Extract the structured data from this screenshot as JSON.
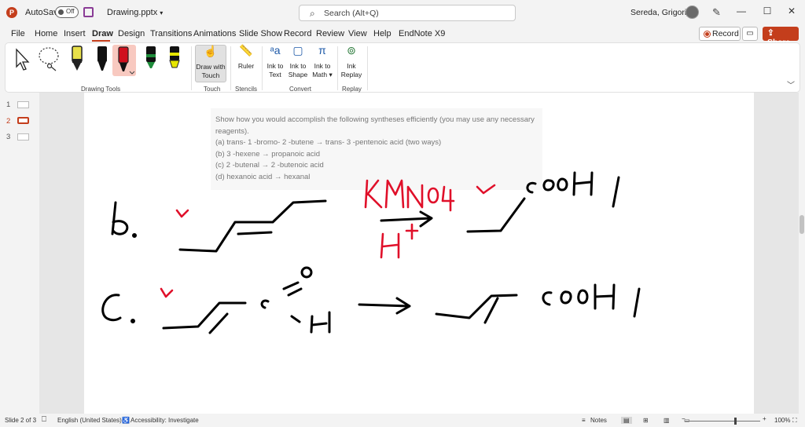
{
  "titlebar": {
    "autosave_label": "AutoSave",
    "autosave_state": "Off",
    "doc_title": "Drawing.pptx",
    "search_placeholder": "Search (Alt+Q)",
    "user_name": "Sereda, Grigoriy A",
    "minimize": "—",
    "maximize": "☐",
    "close": "✕"
  },
  "menu": {
    "tabs": [
      "File",
      "Home",
      "Insert",
      "Draw",
      "Design",
      "Transitions",
      "Animations",
      "Slide Show",
      "Record",
      "Review",
      "View",
      "Help",
      "EndNote X9"
    ],
    "active_tab": "Draw",
    "record_label": "Record",
    "share_label": "Share"
  },
  "ribbon": {
    "groups": {
      "drawing_tools": "Drawing Tools",
      "touch": "Touch",
      "stencils": "Stencils",
      "convert": "Convert",
      "replay": "Replay"
    },
    "buttons": {
      "draw_with_touch_1": "Draw with",
      "draw_with_touch_2": "Touch",
      "ruler": "Ruler",
      "ink_to_text_1": "Ink to",
      "ink_to_text_2": "Text",
      "ink_to_shape_1": "Ink to",
      "ink_to_shape_2": "Shape",
      "ink_to_math_1": "Ink to",
      "ink_to_math_2": "Math",
      "ink_replay_1": "Ink",
      "ink_replay_2": "Replay"
    },
    "pen_colors": [
      "#e8e04a",
      "#111111",
      "#d0101e",
      "#1f8c3b",
      "#e6e600"
    ]
  },
  "thumbnails": [
    "1",
    "2",
    "3"
  ],
  "active_slide": "2",
  "slide": {
    "question": [
      "Show how you would accomplish the following syntheses efficiently (you may use any necessary reagents).",
      "(a) trans- 1 -bromo- 2 -butene → trans- 3 -pentenoic acid (two ways)",
      "(b) 3 -hexene → propanoic acid",
      "(c) 2 -butenal → 2 -butenoic acid",
      "(d) hexanoic acid → hexanal"
    ]
  },
  "statusbar": {
    "slide_info": "Slide 2 of 3",
    "language": "English (United States)",
    "accessibility": "Accessibility: Investigate",
    "notes": "Notes",
    "zoom_minus": "−",
    "zoom_plus": "+",
    "zoom": "100%"
  },
  "colors": {
    "accent": "#c43e1c",
    "ink_black": "#000000",
    "ink_red": "#e0102a"
  }
}
